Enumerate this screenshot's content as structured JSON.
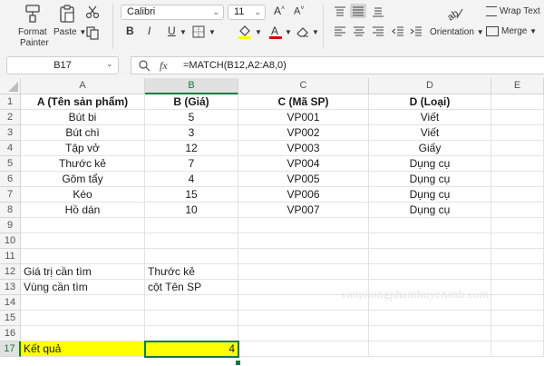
{
  "ribbon": {
    "format_painter_label_1": "Format",
    "format_painter_label_2": "Painter",
    "paste_label": "Paste",
    "font_name": "Calibri",
    "font_size": "11",
    "grow_font": "A",
    "shrink_font": "A",
    "bold": "B",
    "italic": "I",
    "underline": "U",
    "wrap_text": "Wrap Text",
    "orientation": "Orientation",
    "merge": "Merge",
    "font_color_hex": "#d10000",
    "fill_color_hex": "#ffff00"
  },
  "formula_bar": {
    "name_box": "B17",
    "fx": "fx",
    "formula": "=MATCH(B12,A2:A8,0)"
  },
  "columns": [
    "A",
    "B",
    "C",
    "D",
    "E"
  ],
  "selected_column": "B",
  "rows": [
    "1",
    "2",
    "3",
    "4",
    "5",
    "6",
    "7",
    "8",
    "9",
    "10",
    "11",
    "12",
    "13",
    "14",
    "15",
    "16",
    "17"
  ],
  "selected_row": "17",
  "cells": {
    "A1": "A (Tên sản phẩm)",
    "B1": "B (Giá)",
    "C1": "C (Mã SP)",
    "D1": "D (Loại)",
    "A2": "Bút bi",
    "B2": "5",
    "C2": "VP001",
    "D2": "Viết",
    "A3": "Bút chì",
    "B3": "3",
    "C3": "VP002",
    "D3": "Viết",
    "A4": "Tập vở",
    "B4": "12",
    "C4": "VP003",
    "D4": "Giấy",
    "A5": "Thước kẻ",
    "B5": "7",
    "C5": "VP004",
    "D5": "Dụng cụ",
    "A6": "Gôm tẩy",
    "B6": "4",
    "C6": "VP005",
    "D6": "Dụng cụ",
    "A7": "Kéo",
    "B7": "15",
    "C7": "VP006",
    "D7": "Dụng cụ",
    "A8": "Hồ dán",
    "B8": "10",
    "C8": "VP007",
    "D8": "Dụng cụ",
    "A12": "Giá trị cần tìm",
    "B12": "Thước kẻ",
    "A13": "Vùng cần tìm",
    "B13": "cột Tên SP",
    "A17": "Kết quả",
    "B17": "4"
  },
  "highlight_color": "#ffff00",
  "accent_color": "#107c41",
  "watermark": "vanphongphamhuyenanh.com"
}
